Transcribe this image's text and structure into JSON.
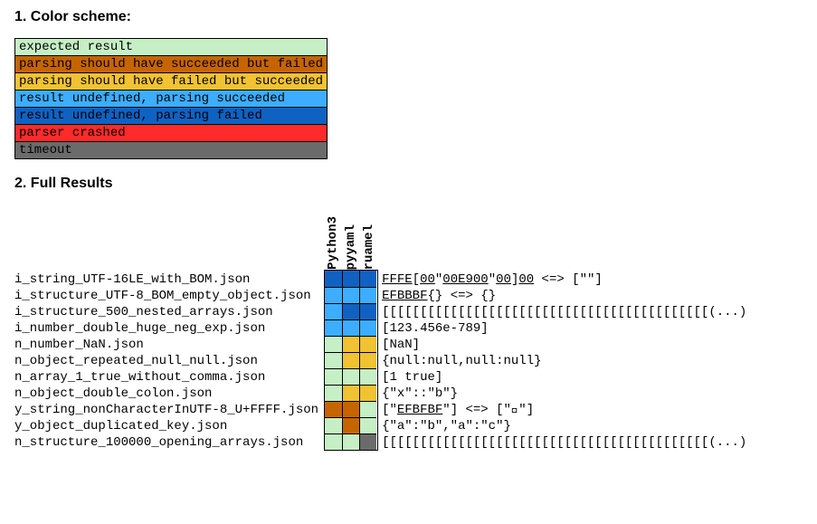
{
  "headings": {
    "scheme": "1. Color scheme:",
    "results": "2. Full Results"
  },
  "legend": [
    {
      "label": "expected result",
      "class": "c-expected"
    },
    {
      "label": "parsing should have succeeded but failed",
      "class": "c-fail-should-succ"
    },
    {
      "label": "parsing should have failed but succeeded",
      "class": "c-succ-should-fail"
    },
    {
      "label": "result undefined, parsing succeeded",
      "class": "c-undef-succ"
    },
    {
      "label": "result undefined, parsing failed",
      "class": "c-undef-fail"
    },
    {
      "label": "parser crashed",
      "class": "c-crash"
    },
    {
      "label": "timeout",
      "class": "c-timeout"
    }
  ],
  "parsers": [
    "Python3",
    "pyyaml",
    "ruamel"
  ],
  "rows": [
    {
      "file": "i_string_UTF-16LE_with_BOM.json",
      "cells": [
        "c-undef-fail",
        "c-undef-fail",
        "c-undef-fail"
      ],
      "raw": [
        {
          "t": "FFFE",
          "u": true
        },
        {
          "t": "["
        },
        {
          "t": "00",
          "u": true
        },
        {
          "t": "\""
        },
        {
          "t": "00E900",
          "u": true
        },
        {
          "t": "\""
        },
        {
          "t": "00",
          "u": true
        },
        {
          "t": "]"
        },
        {
          "t": "00",
          "u": true
        },
        {
          "t": " <=> [\"\"]"
        }
      ]
    },
    {
      "file": "i_structure_UTF-8_BOM_empty_object.json",
      "cells": [
        "c-undef-succ",
        "c-undef-succ",
        "c-undef-succ"
      ],
      "raw": [
        {
          "t": "EFBBBF",
          "u": true
        },
        {
          "t": "{} <=> {}"
        }
      ]
    },
    {
      "file": "i_structure_500_nested_arrays.json",
      "cells": [
        "c-undef-succ",
        "c-undef-fail",
        "c-undef-fail"
      ],
      "raw": [
        {
          "t": "[[[[[[[[[[[[[[[[[[[[[[[[[[[[[[[[[[[[[[[[[[[(...)"
        }
      ]
    },
    {
      "file": "i_number_double_huge_neg_exp.json",
      "cells": [
        "c-undef-succ",
        "c-undef-succ",
        "c-undef-succ"
      ],
      "raw": [
        {
          "t": "[123.456e-789]"
        }
      ]
    },
    {
      "file": "n_number_NaN.json",
      "cells": [
        "c-expected",
        "c-succ-should-fail",
        "c-succ-should-fail"
      ],
      "raw": [
        {
          "t": "[NaN]"
        }
      ]
    },
    {
      "file": "n_object_repeated_null_null.json",
      "cells": [
        "c-expected",
        "c-succ-should-fail",
        "c-succ-should-fail"
      ],
      "raw": [
        {
          "t": "{null:null,null:null}"
        }
      ]
    },
    {
      "file": "n_array_1_true_without_comma.json",
      "cells": [
        "c-expected",
        "c-expected",
        "c-expected"
      ],
      "raw": [
        {
          "t": "[1 true]"
        }
      ]
    },
    {
      "file": "n_object_double_colon.json",
      "cells": [
        "c-expected",
        "c-succ-should-fail",
        "c-succ-should-fail"
      ],
      "raw": [
        {
          "t": "{\"x\"::\"b\"}"
        }
      ]
    },
    {
      "file": "y_string_nonCharacterInUTF-8_U+FFFF.json",
      "cells": [
        "c-fail-should-succ",
        "c-fail-should-succ",
        "c-expected"
      ],
      "raw": [
        {
          "t": "[\""
        },
        {
          "t": "EFBFBF",
          "u": true
        },
        {
          "t": "\"] <=> [\"￿\"]"
        }
      ]
    },
    {
      "file": "y_object_duplicated_key.json",
      "cells": [
        "c-expected",
        "c-fail-should-succ",
        "c-expected"
      ],
      "raw": [
        {
          "t": "{\"a\":\"b\",\"a\":\"c\"}"
        }
      ]
    },
    {
      "file": "n_structure_100000_opening_arrays.json",
      "cells": [
        "c-expected",
        "c-expected",
        "c-timeout"
      ],
      "raw": [
        {
          "t": "[[[[[[[[[[[[[[[[[[[[[[[[[[[[[[[[[[[[[[[[[[[(...)"
        }
      ]
    }
  ]
}
